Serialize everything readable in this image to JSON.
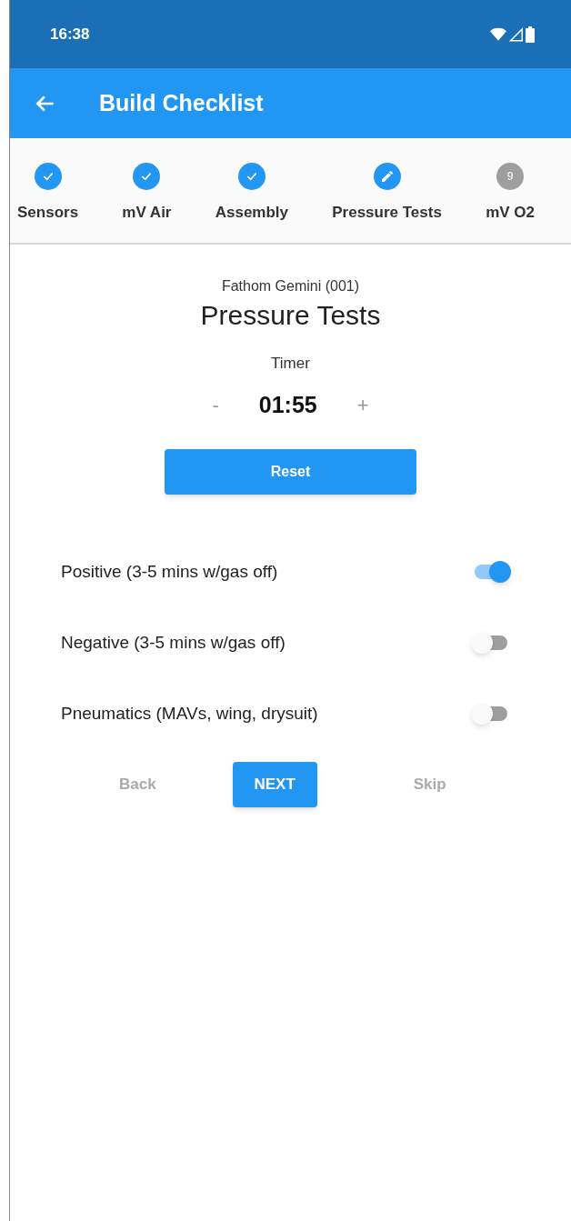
{
  "status_bar": {
    "time": "16:38"
  },
  "app_bar": {
    "title": "Build Checklist"
  },
  "steps": [
    {
      "label": "Sensors",
      "kind": "done"
    },
    {
      "label": "mV Air",
      "kind": "done"
    },
    {
      "label": "Assembly",
      "kind": "done"
    },
    {
      "label": "Pressure Tests",
      "kind": "current"
    },
    {
      "label": "mV O2",
      "kind": "pending",
      "number": "9"
    }
  ],
  "device": "Fathom Gemini (001)",
  "heading": "Pressure Tests",
  "timer": {
    "label": "Timer",
    "minus": "-",
    "value": "01:55",
    "plus": "+",
    "reset": "Reset"
  },
  "checks": [
    {
      "label": "Positive (3-5 mins w/gas off)",
      "on": true
    },
    {
      "label": "Negative (3-5 mins w/gas off)",
      "on": false
    },
    {
      "label": "Pneumatics (MAVs, wing, drysuit)",
      "on": false
    }
  ],
  "nav": {
    "back": "Back",
    "next": "NEXT",
    "skip": "Skip"
  }
}
